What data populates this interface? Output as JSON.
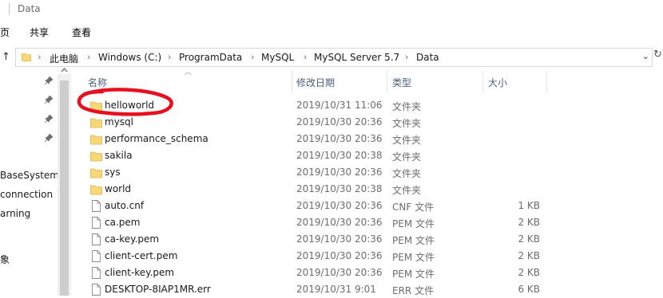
{
  "window": {
    "title": "Data"
  },
  "ribbon": {
    "tabs": [
      "页",
      "共享",
      "查看"
    ]
  },
  "address": {
    "crumbs": [
      "此电脑",
      "Windows (C:)",
      "ProgramData",
      "MySQL",
      "MySQL Server 5.7",
      "Data"
    ]
  },
  "nav": {
    "items": [
      "BaseSystem",
      "connection",
      "arning",
      "象"
    ]
  },
  "columns": {
    "name": "名称",
    "date": "修改日期",
    "type": "类型",
    "size": "大小"
  },
  "files": [
    {
      "name": "helloworld",
      "date": "2019/10/31 11:06",
      "type": "文件夹",
      "size": "",
      "icon": "folder-icon"
    },
    {
      "name": "mysql",
      "date": "2019/10/30 20:36",
      "type": "文件夹",
      "size": "",
      "icon": "folder-icon"
    },
    {
      "name": "performance_schema",
      "date": "2019/10/30 20:36",
      "type": "文件夹",
      "size": "",
      "icon": "folder-icon"
    },
    {
      "name": "sakila",
      "date": "2019/10/30 20:38",
      "type": "文件夹",
      "size": "",
      "icon": "folder-icon"
    },
    {
      "name": "sys",
      "date": "2019/10/30 20:36",
      "type": "文件夹",
      "size": "",
      "icon": "folder-icon"
    },
    {
      "name": "world",
      "date": "2019/10/30 20:38",
      "type": "文件夹",
      "size": "",
      "icon": "folder-icon"
    },
    {
      "name": "auto.cnf",
      "date": "2019/10/30 20:36",
      "type": "CNF 文件",
      "size": "1 KB",
      "icon": "file-icon"
    },
    {
      "name": "ca.pem",
      "date": "2019/10/30 20:36",
      "type": "PEM 文件",
      "size": "2 KB",
      "icon": "file-icon"
    },
    {
      "name": "ca-key.pem",
      "date": "2019/10/30 20:36",
      "type": "PEM 文件",
      "size": "2 KB",
      "icon": "file-icon"
    },
    {
      "name": "client-cert.pem",
      "date": "2019/10/30 20:36",
      "type": "PEM 文件",
      "size": "2 KB",
      "icon": "file-icon"
    },
    {
      "name": "client-key.pem",
      "date": "2019/10/30 20:36",
      "type": "PEM 文件",
      "size": "2 KB",
      "icon": "file-icon"
    },
    {
      "name": "DESKTOP-8IAP1MR.err",
      "date": "2019/10/31 9:01",
      "type": "ERR 文件",
      "size": "6 KB",
      "icon": "file-icon"
    }
  ],
  "colors": {
    "folder": "#f8d775",
    "header_text": "#4c607a",
    "annotation": "#e8101e"
  }
}
